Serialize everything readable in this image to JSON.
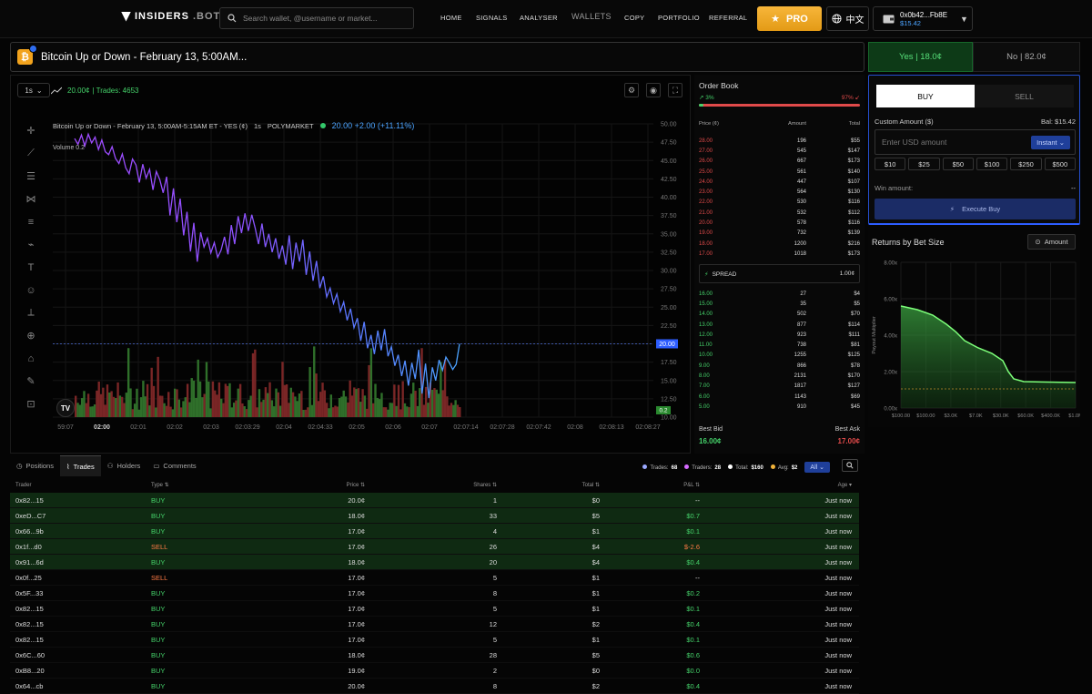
{
  "nav": {
    "logo_main": "INSIDERS",
    "logo_suffix": ".BOT",
    "search_placeholder": "Search wallet, @username or market...",
    "links": [
      "HOME",
      "SIGNALS",
      "ANALYSER",
      "WALLETS",
      "COPY",
      "PORTFOLIO",
      "REFERRAL"
    ],
    "pro": "PRO",
    "lang": "中文",
    "wallet_addr": "0x0b42...Fb8E",
    "wallet_bal": "$15.42"
  },
  "market": {
    "title": "Bitcoin Up or Down - February 13, 5:00AM..."
  },
  "chart": {
    "timeframe": "1s",
    "price_info": "20.00¢",
    "trades_info": "| Trades: 4653",
    "legend_name": "Bitcoin Up or Down - February 13, 5:00AM-5:15AM ET - YES (¢)",
    "legend_tf": "1s",
    "legend_src": "POLYMARKET",
    "legend_price": "20.00 +2.00 (+11.11%)",
    "volume_label": "Volume 0.2",
    "tv_logo": "TV"
  },
  "chart_data": {
    "type": "line",
    "yticks": [
      "50.00",
      "47.50",
      "45.00",
      "42.50",
      "40.00",
      "37.50",
      "35.00",
      "32.50",
      "30.00",
      "27.50",
      "25.00",
      "22.50",
      "20.00",
      "17.50",
      "15.00",
      "12.50",
      "10.00"
    ],
    "xticks": [
      "59:07",
      "02:00",
      "02:01",
      "02:02",
      "02:03",
      "02:03:29",
      "02:04",
      "02:04:33",
      "02:05",
      "02:06",
      "02:07",
      "02:07:14",
      "02:07:28",
      "02:07:42",
      "02:08",
      "02:08:13",
      "02:08:27"
    ],
    "current_price_tag": "20.00",
    "volume_tag": "0.2",
    "prices": [
      48,
      47.2,
      48.5,
      47,
      48.6,
      47.4,
      48.2,
      46.5,
      47.8,
      46.2,
      45.8,
      46.9,
      45.3,
      44.6,
      45.9,
      44,
      43.2,
      45.2,
      44.4,
      42,
      44.5,
      42.6,
      43.8,
      41,
      43.5,
      42.4,
      40.6,
      42.8,
      37.5,
      41.2,
      36.6,
      39.8,
      34.8,
      38,
      32.6,
      36.5,
      31.2,
      35.2,
      33.2,
      34.4,
      32.4,
      33.8,
      31.8,
      32.8,
      34.6,
      32.2,
      36.2,
      33.6,
      37.4,
      35.1,
      37.8,
      35.4,
      37.6,
      35.8,
      33.6,
      36.4,
      33.2,
      35,
      32.5,
      34.4,
      31.6,
      33.4,
      30.8,
      34.8,
      30.2,
      33.8,
      31.2,
      34.2,
      29.4,
      32.6,
      28.6,
      31.3,
      27.6,
      29.2,
      26.4,
      27.6,
      25.5,
      26.8,
      24.4,
      25.7,
      23.2,
      24.8,
      22.2,
      23.5,
      20.4,
      23,
      19.4,
      21.2,
      18.6,
      21.8,
      19.1,
      22,
      18.3,
      19.6,
      17,
      18.5,
      15.6,
      17.7,
      14.3,
      17.4,
      15.2,
      19.2,
      13.2,
      17.3,
      12.6,
      16.8,
      15,
      17.8,
      16.4,
      18.2,
      17.4,
      16.5,
      17.2,
      20
    ]
  },
  "orderbook": {
    "title": "Order Book",
    "yes_pct": "3%",
    "no_pct": "97%",
    "yes_fill": 0.03,
    "head": [
      "Price (¢)",
      "Amount",
      "Total"
    ],
    "asks": [
      [
        "28.00",
        "196",
        "$55"
      ],
      [
        "27.00",
        "545",
        "$147"
      ],
      [
        "26.00",
        "667",
        "$173"
      ],
      [
        "25.00",
        "561",
        "$140"
      ],
      [
        "24.00",
        "447",
        "$107"
      ],
      [
        "23.00",
        "564",
        "$130"
      ],
      [
        "22.00",
        "530",
        "$116"
      ],
      [
        "21.00",
        "532",
        "$112"
      ],
      [
        "20.00",
        "578",
        "$116"
      ],
      [
        "19.00",
        "732",
        "$139"
      ],
      [
        "18.00",
        "1200",
        "$216"
      ],
      [
        "17.00",
        "1018",
        "$173"
      ]
    ],
    "spread_label": "SPREAD",
    "spread_val": "1.00¢",
    "bids": [
      [
        "16.00",
        "27",
        "$4"
      ],
      [
        "15.00",
        "35",
        "$5"
      ],
      [
        "14.00",
        "502",
        "$70"
      ],
      [
        "13.00",
        "877",
        "$114"
      ],
      [
        "12.00",
        "923",
        "$111"
      ],
      [
        "11.00",
        "738",
        "$81"
      ],
      [
        "10.00",
        "1255",
        "$125"
      ],
      [
        "9.00",
        "866",
        "$78"
      ],
      [
        "8.00",
        "2131",
        "$170"
      ],
      [
        "7.00",
        "1817",
        "$127"
      ],
      [
        "6.00",
        "1143",
        "$69"
      ],
      [
        "5.00",
        "910",
        "$45"
      ]
    ],
    "best_bid_label": "Best Bid",
    "best_ask_label": "Best Ask",
    "best_bid": "16.00¢",
    "best_ask": "17.00¢"
  },
  "trade": {
    "yes": "Yes | 18.0¢",
    "no": "No | 82.0¢",
    "buy": "BUY",
    "sell": "SELL",
    "custom_label": "Custom Amount ($)",
    "bal": "Bal: $15.42",
    "placeholder": "Enter USD amount",
    "instant": "Instant",
    "amounts": [
      "$10",
      "$25",
      "$50",
      "$100",
      "$250",
      "$500"
    ],
    "win_label": "Win amount:",
    "win_val": "--",
    "execute": "Execute Buy"
  },
  "returns": {
    "title": "Returns by Bet Size",
    "amount_btn": "Amount",
    "ylabel": "Payout Multiplier",
    "yticks": [
      "8.00x",
      "6.00x",
      "4.00x",
      "2.00x",
      "0.00x"
    ],
    "xticks": [
      "$100.00",
      "$100.00",
      "$3.0K",
      "$7.0K",
      "$30.0K",
      "$60.0K",
      "$400.0K",
      "$1.0M"
    ]
  },
  "bottom": {
    "tabs": [
      "Positions",
      "Trades",
      "Holders",
      "Comments"
    ],
    "stats": {
      "trades_label": "Trades:",
      "trades": "68",
      "traders_label": "Traders:",
      "traders": "28",
      "total_label": "Total:",
      "total": "$160",
      "avg_label": "Avg:",
      "avg": "$2"
    },
    "all": "All",
    "head": [
      "Trader",
      "Type ⇅",
      "Price ⇅",
      "Shares ⇅",
      "Total ⇅",
      "P&L ⇅",
      "Age ▾"
    ],
    "rows": [
      {
        "t": "0x82...15",
        "type": "BUY",
        "p": "20.0¢",
        "s": "1",
        "tot": "$0",
        "pl": "--",
        "age": "Just now",
        "hl": true
      },
      {
        "t": "0xeD...C7",
        "type": "BUY",
        "p": "18.0¢",
        "s": "33",
        "tot": "$5",
        "pl": "$0.7",
        "age": "Just now",
        "hl": true
      },
      {
        "t": "0x66...9b",
        "type": "BUY",
        "p": "17.0¢",
        "s": "4",
        "tot": "$1",
        "pl": "$0.1",
        "age": "Just now",
        "hl": true
      },
      {
        "t": "0x1f...d0",
        "type": "SELL",
        "p": "17.0¢",
        "s": "26",
        "tot": "$4",
        "pl": "$-2.6",
        "age": "Just now",
        "hl": true
      },
      {
        "t": "0x91...6d",
        "type": "BUY",
        "p": "18.0¢",
        "s": "20",
        "tot": "$4",
        "pl": "$0.4",
        "age": "Just now",
        "hl": true
      },
      {
        "t": "0x0f...25",
        "type": "SELL",
        "p": "17.0¢",
        "s": "5",
        "tot": "$1",
        "pl": "--",
        "age": "Just now",
        "hl": false
      },
      {
        "t": "0x5F...33",
        "type": "BUY",
        "p": "17.0¢",
        "s": "8",
        "tot": "$1",
        "pl": "$0.2",
        "age": "Just now",
        "hl": false
      },
      {
        "t": "0x82...15",
        "type": "BUY",
        "p": "17.0¢",
        "s": "5",
        "tot": "$1",
        "pl": "$0.1",
        "age": "Just now",
        "hl": false
      },
      {
        "t": "0x82...15",
        "type": "BUY",
        "p": "17.0¢",
        "s": "12",
        "tot": "$2",
        "pl": "$0.4",
        "age": "Just now",
        "hl": false
      },
      {
        "t": "0x82...15",
        "type": "BUY",
        "p": "17.0¢",
        "s": "5",
        "tot": "$1",
        "pl": "$0.1",
        "age": "Just now",
        "hl": false
      },
      {
        "t": "0x6C...60",
        "type": "BUY",
        "p": "18.0¢",
        "s": "28",
        "tot": "$5",
        "pl": "$0.6",
        "age": "Just now",
        "hl": false
      },
      {
        "t": "0xB8...20",
        "type": "BUY",
        "p": "19.0¢",
        "s": "2",
        "tot": "$0",
        "pl": "$0.0",
        "age": "Just now",
        "hl": false
      },
      {
        "t": "0x64...cb",
        "type": "BUY",
        "p": "20.0¢",
        "s": "8",
        "tot": "$2",
        "pl": "$0.4",
        "age": "Just now",
        "hl": false
      }
    ]
  }
}
